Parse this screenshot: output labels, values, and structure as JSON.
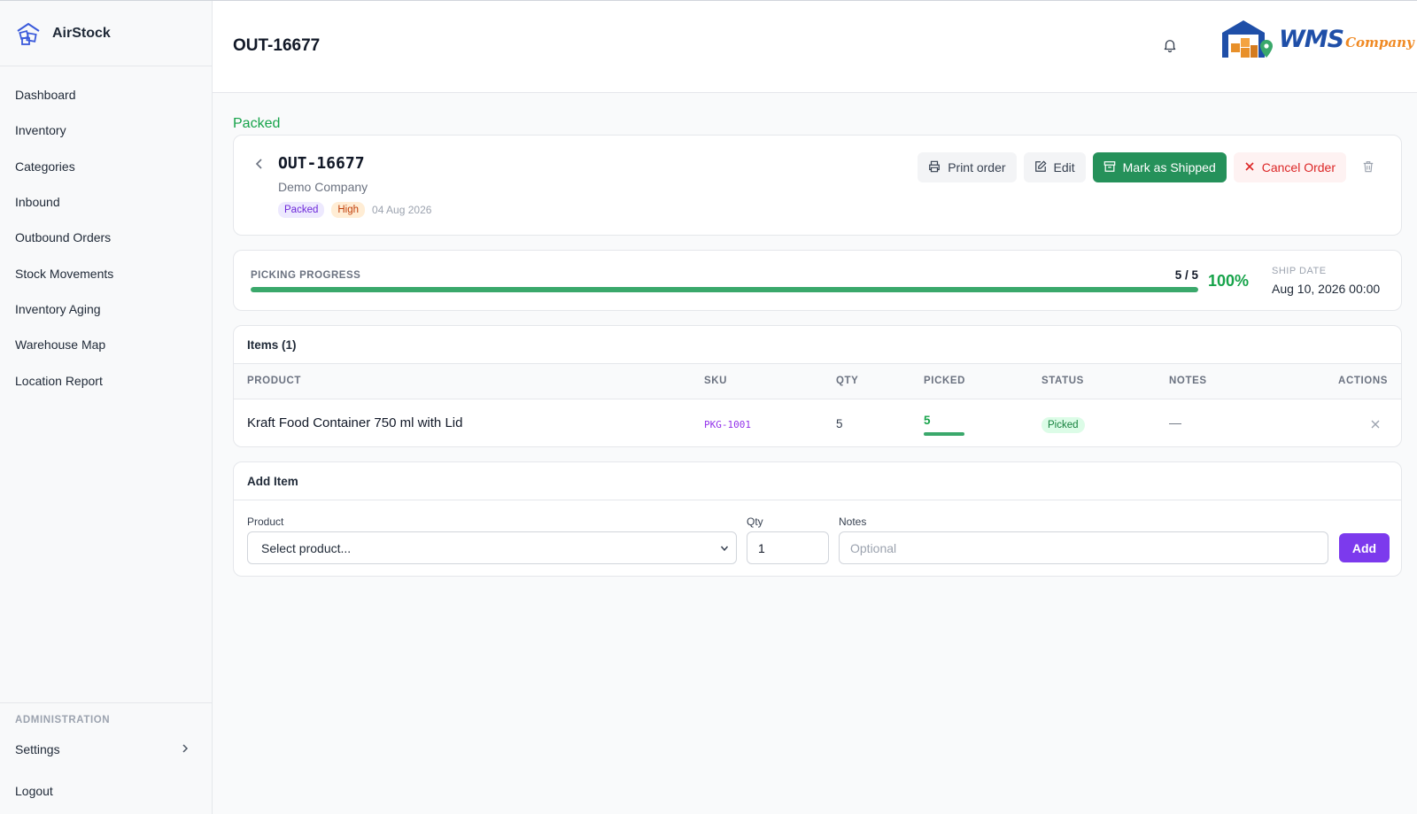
{
  "app": {
    "name": "AirStock"
  },
  "sidebar": {
    "items": [
      {
        "label": "Dashboard"
      },
      {
        "label": "Inventory"
      },
      {
        "label": "Categories"
      },
      {
        "label": "Inbound"
      },
      {
        "label": "Outbound Orders"
      },
      {
        "label": "Stock Movements"
      },
      {
        "label": "Inventory Aging"
      },
      {
        "label": "Warehouse Map"
      },
      {
        "label": "Location Report"
      }
    ],
    "admin_title": "ADMINISTRATION",
    "settings_label": "Settings",
    "logout_label": "Logout"
  },
  "header": {
    "title": "OUT-16677",
    "logo_text": "WMS",
    "logo_sub": "Company"
  },
  "order": {
    "status_heading": "Packed",
    "id": "OUT-16677",
    "company": "Demo Company",
    "status_tag": "Packed",
    "priority_tag": "High",
    "date": "04 Aug 2026",
    "actions": {
      "print": "Print order",
      "edit": "Edit",
      "ship": "Mark as Shipped",
      "cancel": "Cancel Order"
    }
  },
  "progress": {
    "label": "PICKING PROGRESS",
    "count": "5 / 5",
    "percent_text": "100%",
    "fraction": 1.0,
    "ship_label": "SHIP DATE",
    "ship_date": "Aug 10, 2026 00:00"
  },
  "items": {
    "title": "Items (1)",
    "columns": [
      "PRODUCT",
      "SKU",
      "QTY",
      "PICKED",
      "STATUS",
      "NOTES",
      "ACTIONS"
    ],
    "rows": [
      {
        "product": "Kraft Food Container 750 ml with Lid",
        "sku": "PKG-1001",
        "qty": "5",
        "picked": "5",
        "picked_fraction": 1.0,
        "status": "Picked",
        "notes": "—"
      }
    ]
  },
  "add_item": {
    "title": "Add Item",
    "product_label": "Product",
    "product_value": "Select product...",
    "qty_label": "Qty",
    "qty_value": "1",
    "notes_label": "Notes",
    "notes_placeholder": "Optional",
    "add_label": "Add"
  },
  "colors": {
    "accent_green": "#25915a",
    "accent_purple": "#7c3aed",
    "danger": "#dc2626"
  }
}
